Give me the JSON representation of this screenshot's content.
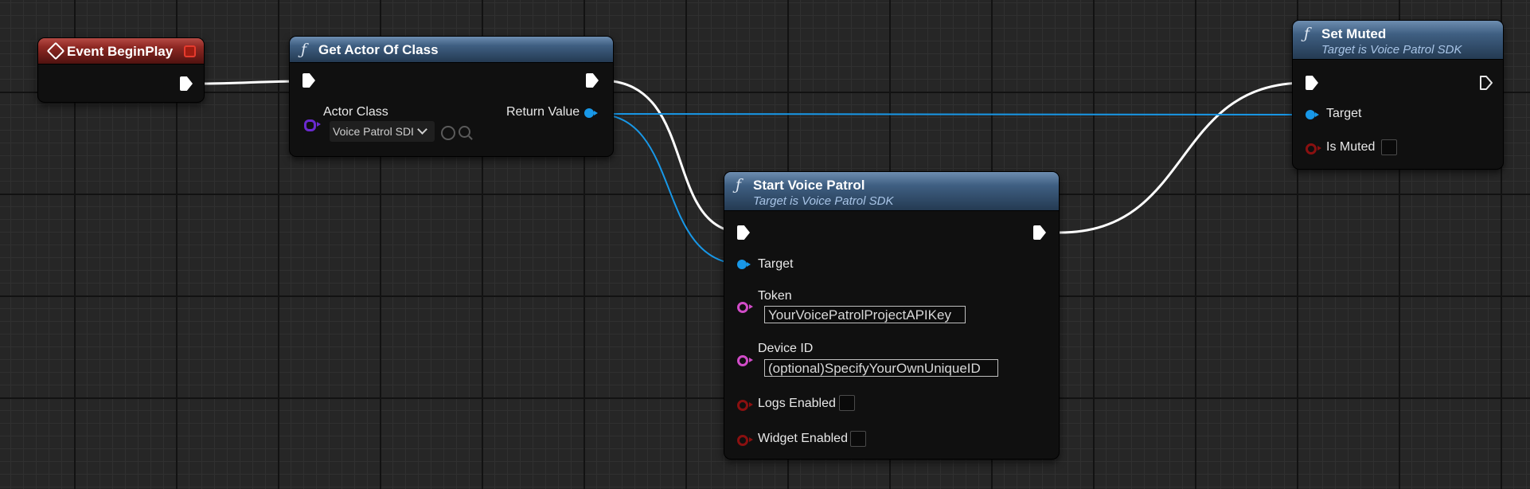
{
  "nodes": {
    "event_begin_play": {
      "title": "Event BeginPlay"
    },
    "get_actor_of_class": {
      "title": "Get Actor Of Class",
      "actor_class_label": "Actor Class",
      "actor_class_value": "Voice Patrol SDI",
      "return_value_label": "Return Value"
    },
    "start_voice_patrol": {
      "title": "Start Voice Patrol",
      "subtitle": "Target is Voice Patrol SDK",
      "target_label": "Target",
      "token_label": "Token",
      "token_value": "YourVoicePatrolProjectAPIKey",
      "device_id_label": "Device ID",
      "device_id_value": "(optional)SpecifyYourOwnUniqueID",
      "logs_enabled_label": "Logs Enabled",
      "widget_enabled_label": "Widget Enabled"
    },
    "set_muted": {
      "title": "Set Muted",
      "subtitle": "Target is Voice Patrol SDK",
      "target_label": "Target",
      "is_muted_label": "Is Muted"
    }
  },
  "colors": {
    "exec_wire": "#ffffff",
    "object_wire": "#1898e8",
    "function_header": "#3f5f82",
    "event_header": "#8e2823",
    "string_pin": "#d14cc8",
    "bool_pin": "#8a1010",
    "class_pin": "#6a2ad0"
  }
}
